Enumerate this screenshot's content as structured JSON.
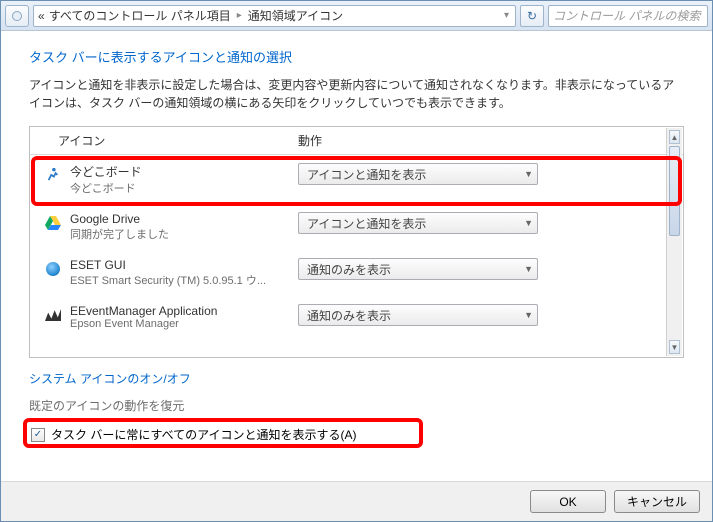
{
  "breadcrumb": {
    "back_glyph": "«",
    "parent": "すべてのコントロール パネル項目",
    "sep": "▸",
    "current": "通知領域アイコン",
    "dropdown_glyph": "▾",
    "refresh_glyph": "↻"
  },
  "search": {
    "placeholder": "コントロール パネルの検索"
  },
  "page": {
    "title": "タスク バーに表示するアイコンと通知の選択",
    "desc": "アイコンと通知を非表示に設定した場合は、変更内容や更新内容について通知されなくなります。非表示になっているアイコンは、タスク バーの通知領域の横にある矢印をクリックしていつでも表示できます。"
  },
  "table": {
    "col_icon": "アイコン",
    "col_action": "動作"
  },
  "rows": [
    {
      "title": "今どこボード",
      "sub": "今どこボード",
      "action": "アイコンと通知を表示",
      "icon": "imadoko"
    },
    {
      "title": "Google Drive",
      "sub": "同期が完了しました",
      "action": "アイコンと通知を表示",
      "icon": "gdrive"
    },
    {
      "title": "ESET GUI",
      "sub": "ESET Smart Security (TM) 5.0.95.1 ウ...",
      "action": "通知のみを表示",
      "icon": "eset"
    },
    {
      "title": "EEventManager Application",
      "sub": "Epson Event Manager",
      "action": "通知のみを表示",
      "icon": "epson"
    }
  ],
  "links": {
    "system_icons": "システム アイコンのオン/オフ",
    "restore_defaults": "既定のアイコンの動作を復元"
  },
  "checkbox": {
    "label": "タスク バーに常にすべてのアイコンと通知を表示する(A)",
    "checked": true
  },
  "buttons": {
    "ok": "OK",
    "cancel": "キャンセル"
  }
}
